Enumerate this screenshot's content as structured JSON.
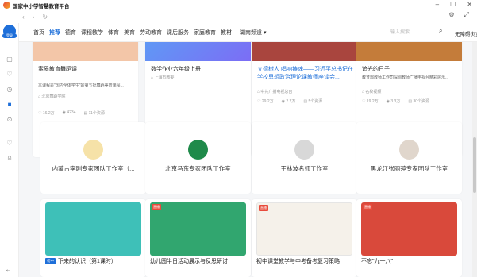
{
  "app": {
    "title": "国家中小学智慧教育平台"
  },
  "sidebar": {
    "avatar_label": "登录"
  },
  "nav": {
    "categories": [
      "首页",
      "推荐",
      "德育",
      "课程教学",
      "体育",
      "美育",
      "劳动教育",
      "课后服务",
      "家庭教育",
      "教材"
    ],
    "active": "推荐",
    "region": "湖南频道",
    "search_placeholder": "输入搜索",
    "login": "无障碍浏览"
  },
  "row1": [
    {
      "title": "素质教育舞蹈课",
      "desc": "本课程是\"国内全体学生\"的第五批舞蹈美育课程...",
      "org": "北京舞蹈学院",
      "likes": "16.2万",
      "views": "4234",
      "count": "11个资源",
      "banner": "#f3c6a8"
    },
    {
      "title": "数学作业六年级上册",
      "desc": "",
      "org": "上海市教委",
      "likes": "",
      "views": "",
      "count": "",
      "banner": "#5e9bf5"
    },
    {
      "title": "立德树人 唱响铸魂——习近平总书记在学校思想政治理论课教师座谈会...",
      "desc": "",
      "org": "中共广播电视总台",
      "likes": "29.2万",
      "views": "2.2万",
      "count": "5个资源",
      "banner": "#a9453e"
    },
    {
      "title": "追光的日子",
      "desc": "教育部教师工作司深圳教师广播电视台精彩展示...",
      "org": "名校视频",
      "likes": "19.2万",
      "views": "3.3万",
      "count": "30个资源",
      "banner": "#c47c3a"
    }
  ],
  "row2": [
    {
      "name": "内蒙古李刚专家团队工作室（...",
      "logo": "#e4b447"
    },
    {
      "name": "北京马东专家团队工作室",
      "logo": "#1f8a4a"
    },
    {
      "name": "王林波名师工作室",
      "logo": "#3a3a3a"
    },
    {
      "name": "黑龙江张丽萍专家团队工作室",
      "logo": "#8a5a3a"
    }
  ],
  "row3": [
    {
      "tag": "初中",
      "title": "下来的认识（第1课时）",
      "badge": "",
      "thumb": "#3ec0b8"
    },
    {
      "tag": "",
      "title": "幼儿园半日活动展示与反思研讨",
      "badge": "直播",
      "thumb": "#31a66f"
    },
    {
      "tag": "",
      "title": "初中课堂教学与中考备考复习策略",
      "badge": "直播",
      "thumb": "#f5f1ea"
    },
    {
      "tag": "",
      "title": "不忘\"九一八\"",
      "badge": "直播",
      "thumb": "#d9493b"
    }
  ]
}
